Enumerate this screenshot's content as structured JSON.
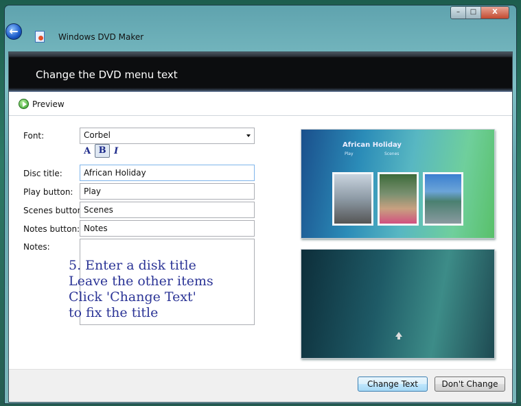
{
  "window": {
    "app_title": "Windows DVD Maker",
    "minimize_icon": "minimize-icon",
    "maximize_icon": "maximize-icon",
    "close_icon": "close-icon"
  },
  "header": {
    "title": "Change the DVD menu text"
  },
  "toolbar": {
    "preview_label": "Preview"
  },
  "form": {
    "font_label": "Font:",
    "font_value": "Corbel",
    "format_buttons": [
      "A",
      "B",
      "I"
    ],
    "disc_title_label": "Disc title:",
    "disc_title_value": "African Holiday",
    "play_label": "Play button:",
    "play_value": "Play",
    "scenes_label": "Scenes button:",
    "scenes_value": "Scenes",
    "notes_button_label": "Notes button:",
    "notes_button_value": "Notes",
    "notes_label": "Notes:",
    "notes_value": ""
  },
  "annotation": "5. Enter a disk title\nLeave the other items\nClick 'Change Text'\nto fix the title",
  "preview": {
    "title": "African Holiday",
    "play": "Play",
    "scenes": "Scenes"
  },
  "footer": {
    "change_text": "Change Text",
    "dont_change": "Don't Change"
  }
}
